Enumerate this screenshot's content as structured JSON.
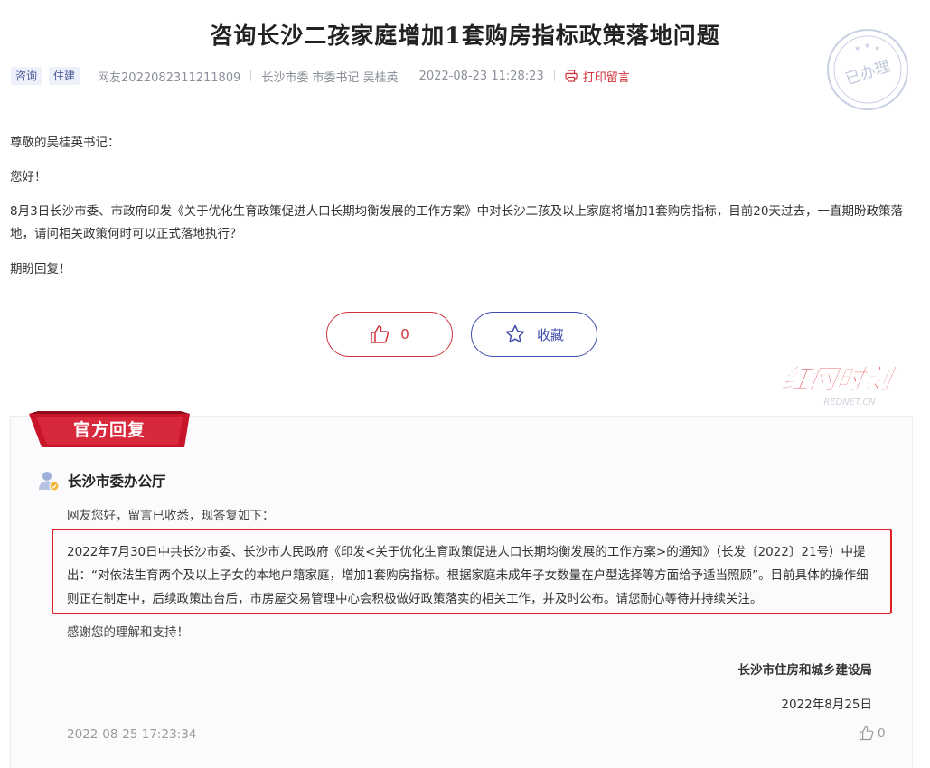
{
  "title": "咨询长沙二孩家庭增加1套购房指标政策落地问题",
  "meta": {
    "tags": [
      "咨询",
      "住建"
    ],
    "user": "网友2022082311211809",
    "target": "长沙市委 市委书记 吴桂英",
    "time": "2022-08-23 11:28:23",
    "print_label": "打印留言"
  },
  "stamp": {
    "text": "已办理"
  },
  "letter": {
    "greeting": "尊敬的吴桂英书记：",
    "hello": "您好！",
    "body": "8月3日长沙市委、市政府印发《关于优化生育政策促进人口长期均衡发展的工作方案》中对长沙二孩及以上家庭将增加1套购房指标，目前20天过去，一直期盼政策落地，请问相关政策何时可以正式落地执行？",
    "closing": "期盼回复！"
  },
  "actions": {
    "like_count": "0",
    "favorite_label": "收藏"
  },
  "logo": {
    "main": "红网时刻",
    "sub": "REDNET.CN"
  },
  "reply": {
    "ribbon": "官方回复",
    "department": "长沙市委办公厅",
    "intro": "网友您好，留言已收悉，现答复如下：",
    "highlight": "2022年7月30日中共长沙市委、长沙市人民政府《印发<关于优化生育政策促进人口长期均衡发展的工作方案>的通知》（长发〔2022〕21号）中提出：“对依法生育两个及以上子女的本地户籍家庭，增加1套购房指标。根据家庭未成年子女数量在户型选择等方面给予适当照顾”。目前具体的操作细则正在制定中，后续政策出台后，市房屋交易管理中心会积极做好政策落实的相关工作，并及时公布。请您耐心等待并持续关注。",
    "thanks": "感谢您的理解和支持！",
    "signer": "长沙市住房和城乡建设局",
    "date": "2022年8月25日",
    "time": "2022-08-25 17:23:34",
    "like_count": "0"
  },
  "colors": {
    "brand_red": "#d0333c",
    "accent_blue": "#3f4bab",
    "highlight_border": "#e02020"
  }
}
